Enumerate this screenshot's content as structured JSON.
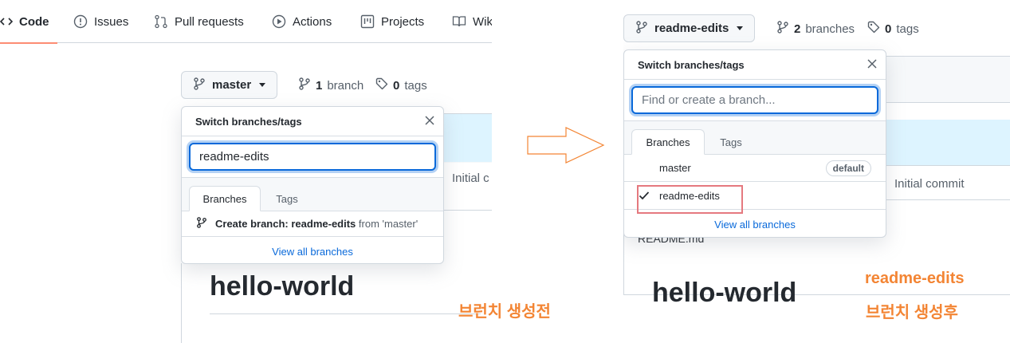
{
  "left": {
    "nav": {
      "code": "Code",
      "issues": "Issues",
      "pull_requests": "Pull requests",
      "actions": "Actions",
      "projects": "Projects",
      "wiki": "Wik"
    },
    "branch_button": "master",
    "branch_count": "1",
    "branch_word": "branch",
    "tag_count": "0",
    "tag_word": "tags",
    "dropdown": {
      "title": "Switch branches/tags",
      "filter_value": "readme-edits",
      "tab_branches": "Branches",
      "tab_tags": "Tags",
      "create_prefix": "Create branch: readme-edits",
      "create_suffix": "from 'master'",
      "view_all": "View all branches"
    },
    "commit_peek": "Initial c",
    "readme_heading": "hello-world"
  },
  "right": {
    "branch_button": "readme-edits",
    "branch_count": "2",
    "branch_word": "branches",
    "tag_count": "0",
    "tag_word": "tags",
    "dropdown": {
      "title": "Switch branches/tags",
      "filter_placeholder": "Find or create a branch...",
      "tab_branches": "Branches",
      "tab_tags": "Tags",
      "branches": [
        {
          "name": "master",
          "badge": "default",
          "selected": false
        },
        {
          "name": "readme-edits",
          "badge": "",
          "selected": true
        }
      ],
      "view_all": "View all branches"
    },
    "commit_message": "Initial commit",
    "readme_file": "README.md",
    "readme_heading": "hello-world"
  },
  "annotations": {
    "before": "브런치 생성전",
    "after_line1": "readme-edits",
    "after_line2": "브런치 생성후",
    "accent_color": "#f38534",
    "highlight_color": "#e5797f"
  }
}
